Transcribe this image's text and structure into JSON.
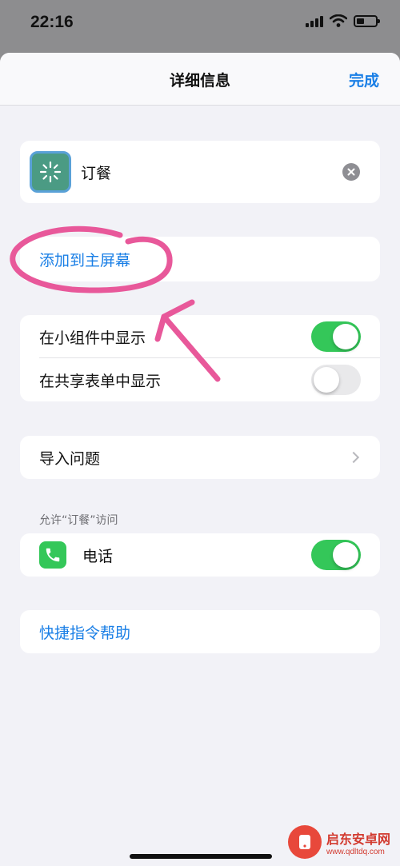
{
  "status_bar": {
    "time": "22:16"
  },
  "nav": {
    "title": "详细信息",
    "done_label": "完成"
  },
  "shortcut": {
    "name": "订餐",
    "icon": "sparkle-icon"
  },
  "add_to_home": {
    "label": "添加到主屏幕"
  },
  "toggles": [
    {
      "label": "在小组件中显示",
      "on": true
    },
    {
      "label": "在共享表单中显示",
      "on": false
    }
  ],
  "import_questions": {
    "label": "导入问题"
  },
  "access": {
    "header": "允许“订餐”访问",
    "items": [
      {
        "label": "电话",
        "icon": "phone-icon",
        "on": true
      }
    ]
  },
  "help": {
    "label": "快捷指令帮助"
  },
  "watermark": {
    "title": "启东安卓网",
    "url": "www.qdltdq.com"
  },
  "colors": {
    "accent": "#1a7fe6",
    "toggle_on": "#34c759",
    "annotation": "#e8589a"
  }
}
